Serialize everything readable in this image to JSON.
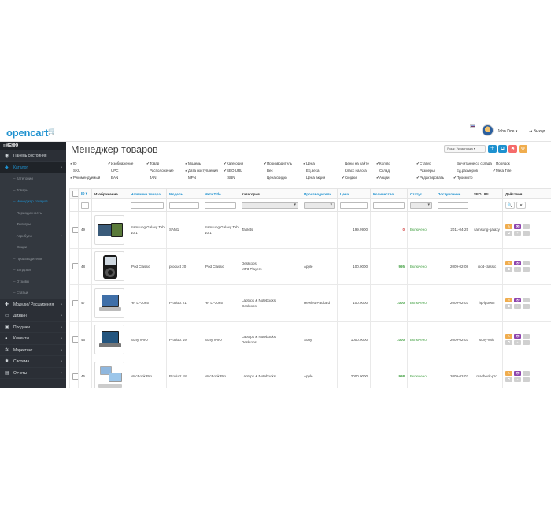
{
  "header": {
    "logo": "opencart",
    "logo_cart": "🛒",
    "user": "John Doe ▾",
    "logout": "Выход"
  },
  "sidebar": {
    "menu_title": "МЕНЮ",
    "items": [
      {
        "label": "Панель состояния",
        "icon": "dashboard-icon",
        "arrow": ""
      },
      {
        "label": "Каталог",
        "icon": "tag-icon",
        "arrow": "›",
        "active": true
      }
    ],
    "catalog_sub": [
      {
        "label": "Категории",
        "arrow": ""
      },
      {
        "label": "Товары",
        "arrow": ""
      },
      {
        "label": "Менеджер товаров",
        "arrow": "",
        "active": true
      },
      {
        "label": "Периодичность",
        "arrow": ""
      },
      {
        "label": "Фильтры",
        "arrow": ""
      },
      {
        "label": "Атрибуты",
        "arrow": "›"
      },
      {
        "label": "Опции",
        "arrow": ""
      },
      {
        "label": "Производители",
        "arrow": ""
      },
      {
        "label": "Загрузки",
        "arrow": ""
      },
      {
        "label": "Отзывы",
        "arrow": ""
      },
      {
        "label": "Статьи",
        "arrow": ""
      }
    ],
    "bottom_items": [
      {
        "label": "Модули / Расширения",
        "icon": "puzzle-icon",
        "arrow": "›"
      },
      {
        "label": "Дизайн",
        "icon": "monitor-icon",
        "arrow": "›"
      },
      {
        "label": "Продажи",
        "icon": "cart-icon",
        "arrow": "›"
      },
      {
        "label": "Клиенты",
        "icon": "user-icon",
        "arrow": "›"
      },
      {
        "label": "Маркетинг",
        "icon": "share-icon",
        "arrow": "›"
      },
      {
        "label": "Система",
        "icon": "gear-icon",
        "arrow": "›"
      },
      {
        "label": "Отчеты",
        "icon": "chart-icon",
        "arrow": "›"
      }
    ]
  },
  "page": {
    "title": "Менеджер товаров",
    "language_select": "Язык: Украинська ▾",
    "toolbar_icons": [
      "＋",
      "⧉",
      "✖",
      "⚙"
    ],
    "toolbar_colors": [
      "#1e91cf",
      "#1e91cf",
      "#f56b6b",
      "#f0ad4e"
    ]
  },
  "columns_picker": [
    {
      "label": "ID",
      "checked": true
    },
    {
      "label": "SKU",
      "checked": false
    },
    {
      "label": "Рекомендуемый",
      "checked": true
    },
    {
      "label": "Изображение",
      "checked": true
    },
    {
      "label": "UPC",
      "checked": false
    },
    {
      "label": "EAN",
      "checked": false
    },
    {
      "label": "Товар",
      "checked": true
    },
    {
      "label": "Расположение",
      "checked": false
    },
    {
      "label": "JAN",
      "checked": false
    },
    {
      "label": "Модель",
      "checked": true
    },
    {
      "label": "Дата поступления",
      "checked": true
    },
    {
      "label": "MPN",
      "checked": false
    },
    {
      "label": "Категория",
      "checked": true
    },
    {
      "label": "SEO URL",
      "checked": true
    },
    {
      "label": "ISBN",
      "checked": false
    },
    {
      "label": "Производитель",
      "checked": true
    },
    {
      "label": "Вес",
      "checked": false
    },
    {
      "label": "Цена скидки",
      "checked": false
    },
    {
      "label": "Цена",
      "checked": true
    },
    {
      "label": "Ед.веса",
      "checked": false
    },
    {
      "label": "Цена акции",
      "checked": false
    },
    {
      "label": "Цены на сайте",
      "checked": false
    },
    {
      "label": "Класс налога",
      "checked": false
    },
    {
      "label": "Скидки",
      "checked": true
    },
    {
      "label": "Кол-во",
      "checked": true
    },
    {
      "label": "Склад",
      "checked": false
    },
    {
      "label": "Акции",
      "checked": true
    },
    {
      "label": "Статус",
      "checked": true
    },
    {
      "label": "Размеры",
      "checked": false
    },
    {
      "label": "Редактировать",
      "checked": true
    },
    {
      "label": "Вычитание со склада",
      "checked": false
    },
    {
      "label": "Ед.размеров",
      "checked": false
    },
    {
      "label": "Просмотр",
      "checked": true
    },
    {
      "label": "Порядок",
      "checked": false
    },
    {
      "label": "Meta Title",
      "checked": true
    }
  ],
  "table": {
    "headers": {
      "id": "ID ▾",
      "image": "Изображение",
      "name": "Название товара",
      "model": "Модель",
      "meta": "Meta Title",
      "category": "Категория",
      "manufacturer": "Производитель",
      "price": "Цена",
      "quantity": "Количество",
      "status": "Статус",
      "date": "Поступление",
      "seo": "SEO URL",
      "actions": "Действия"
    },
    "filter_buttons": [
      "🔍",
      "✕"
    ],
    "rows": [
      {
        "id": "49",
        "image": "tablet",
        "name": "Samsung Galaxy Tab 10.1",
        "model": "SAM1",
        "meta": "Samsung Galaxy Tab 10.1",
        "category": "Tablets",
        "manufacturer": "",
        "price": "199.9900",
        "quantity": "0",
        "status": "Включено",
        "date": "2011-04-25",
        "seo": "samsung-galaxy"
      },
      {
        "id": "48",
        "image": "ipod",
        "name": "iPod Classic",
        "model": "product 20",
        "meta": "iPod Classic",
        "category": "Desktops\nMP3 Players",
        "manufacturer": "Apple",
        "price": "100.0000",
        "quantity": "995",
        "status": "Включено",
        "date": "2009-02-08",
        "seo": "ipod-classic"
      },
      {
        "id": "47",
        "image": "laptop",
        "name": "HP LP3065",
        "model": "Product 21",
        "meta": "HP LP3065",
        "category": "Laptops & Notebooks\nDesktops",
        "manufacturer": "Hewlett-Packard",
        "price": "100.0000",
        "quantity": "1000",
        "status": "Включено",
        "date": "2009-02-03",
        "seo": "hp-lp3065"
      },
      {
        "id": "46",
        "image": "laptop2",
        "name": "Sony VAIO",
        "model": "Product 19",
        "meta": "Sony VAIO",
        "category": "Laptops & Notebooks\nDesktops",
        "manufacturer": "Sony",
        "price": "1000.0000",
        "quantity": "1000",
        "status": "Включено",
        "date": "2009-02-03",
        "seo": "sony-vaio"
      },
      {
        "id": "45",
        "image": "macbook",
        "name": "MacBook Pro",
        "model": "Product 18",
        "meta": "MacBook Pro",
        "category": "Laptops & Notebooks",
        "manufacturer": "Apple",
        "price": "2000.0000",
        "quantity": "998",
        "status": "Включено",
        "date": "2009-02-03",
        "seo": "macbook-pro"
      }
    ],
    "action_icons": [
      "✎",
      "👁",
      " ",
      "⧉",
      "+",
      " "
    ],
    "action_colors": [
      "#f0ad4e",
      "#8e44ad",
      "#d0d0d0",
      "#d0d0d0",
      "#d0d0d0",
      "#d0d0d0"
    ]
  }
}
